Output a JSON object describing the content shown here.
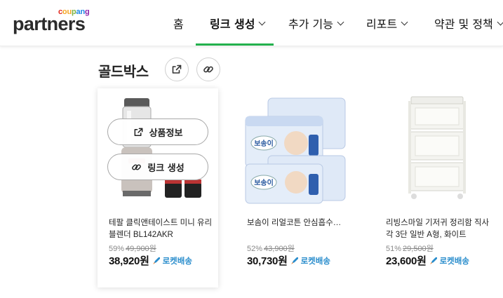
{
  "header": {
    "logo": {
      "brand_top": "coupang",
      "brand_main": "partners"
    },
    "nav": [
      {
        "label": "홈",
        "has_chevron": false,
        "active": false
      },
      {
        "label": "링크 생성",
        "has_chevron": true,
        "active": true
      },
      {
        "label": "추가 기능",
        "has_chevron": true,
        "active": false
      },
      {
        "label": "리포트",
        "has_chevron": true,
        "active": false
      },
      {
        "label": "약관 및 정책",
        "has_chevron": true,
        "active": false
      }
    ],
    "accent_color": "#23b14d"
  },
  "section": {
    "title": "골드박스",
    "actions": [
      {
        "icon": "external-link-icon"
      },
      {
        "icon": "link-icon"
      }
    ]
  },
  "overlay": {
    "product_info_label": "상품정보",
    "create_link_label": "링크 생성"
  },
  "products": [
    {
      "name": "테팔 클릭앤테이스트 미니 유리블렌더 BL142AKR",
      "discount": "59%",
      "original_price": "49,900원",
      "price": "38,920원",
      "badge": "로켓배송",
      "image": "blender-product-image"
    },
    {
      "name": "보솜이 리얼코튼 안심흡수…",
      "discount": "52%",
      "original_price": "43,900원",
      "price": "30,730원",
      "badge": "로켓배송",
      "image": "diaper-pack-product-image"
    },
    {
      "name": "리빙스마일 기저귀 정리함 직사각 3단 일반 A형, 화이트",
      "discount": "51%",
      "original_price": "29,500원",
      "price": "23,600원",
      "badge": "로켓배송",
      "image": "storage-cart-product-image"
    }
  ],
  "colors": {
    "rocket_blue": "#2a8dcc"
  }
}
